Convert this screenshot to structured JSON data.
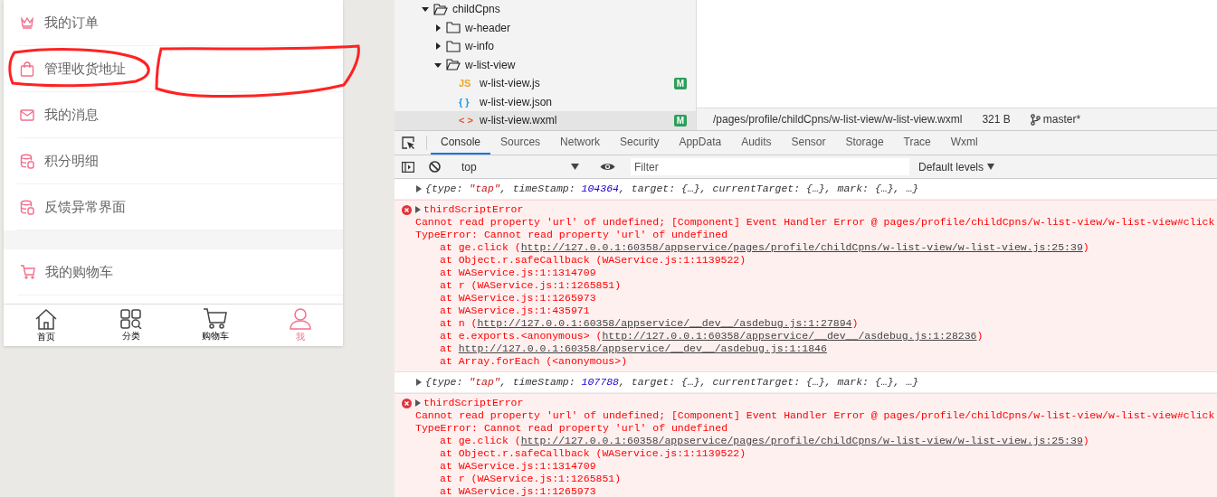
{
  "phone": {
    "menu_groups": [
      {
        "items": [
          {
            "label": "我的订单"
          },
          {
            "label": "管理收货地址"
          },
          {
            "label": "我的消息"
          },
          {
            "label": "积分明细"
          },
          {
            "label": "反馈异常界面"
          }
        ]
      },
      {
        "items": [
          {
            "label": "我的购物车"
          }
        ]
      }
    ],
    "tab_bar": [
      {
        "label": "首页",
        "selected": false
      },
      {
        "label": "分类",
        "selected": false
      },
      {
        "label": "购物车",
        "selected": false
      },
      {
        "label": "我",
        "selected": true
      }
    ]
  },
  "file_tree": [
    {
      "name": "childCpns",
      "kind": "folder",
      "expanded": true,
      "children": [
        {
          "name": "w-header",
          "kind": "folder",
          "expanded": false
        },
        {
          "name": "w-info",
          "kind": "folder",
          "expanded": false
        },
        {
          "name": "w-list-view",
          "kind": "folder",
          "expanded": true,
          "children": [
            {
              "name": "w-list-view.js",
              "kind": "js",
              "icon": "JS",
              "badge": "M",
              "selected": false
            },
            {
              "name": "w-list-view.json",
              "kind": "json",
              "icon": "{ }",
              "selected": false
            },
            {
              "name": "w-list-view.wxml",
              "kind": "wxml",
              "icon": "< >",
              "badge": "M",
              "selected": true
            }
          ]
        }
      ]
    }
  ],
  "status_bar": {
    "path": "/pages/profile/childCpns/w-list-view/w-list-view.wxml",
    "size": "321 B",
    "branch": "master*"
  },
  "devtools_tabs": [
    {
      "label": "Console",
      "selected": true
    },
    {
      "label": "Sources",
      "selected": false
    },
    {
      "label": "Network",
      "selected": false
    },
    {
      "label": "Security",
      "selected": false
    },
    {
      "label": "AppData",
      "selected": false
    },
    {
      "label": "Audits",
      "selected": false
    },
    {
      "label": "Sensor",
      "selected": false
    },
    {
      "label": "Storage",
      "selected": false
    },
    {
      "label": "Trace",
      "selected": false
    },
    {
      "label": "Wxml",
      "selected": false
    }
  ],
  "console_toolbar": {
    "context": "top",
    "filter_placeholder": "Filter",
    "levels": "Default levels"
  },
  "console": [
    {
      "kind": "object",
      "segments": [
        {
          "text": "{type: ",
          "kind": "plain"
        },
        {
          "text": "\"tap\"",
          "kind": "string"
        },
        {
          "text": ", timeStamp: ",
          "kind": "plain"
        },
        {
          "text": "104364",
          "kind": "number"
        },
        {
          "text": ", target: {…}, currentTarget: {…}, mark: {…}, …}",
          "kind": "plain"
        }
      ]
    },
    {
      "kind": "error",
      "title": "thirdScriptError",
      "lines": [
        "Cannot read property 'url' of undefined; [Component] Event Handler Error @ pages/profile/childCpns/w-list-view/w-list-view#click",
        "TypeError: Cannot read property 'url' of undefined"
      ],
      "frames": [
        {
          "text": "at ge.click (",
          "link": "http://127.0.0.1:60358/appservice/pages/profile/childCpns/w-list-view/w-list-view.js:25:39",
          "end": ")"
        },
        {
          "text": "at Object.r.safeCallback (WAService.js:1:1139522)"
        },
        {
          "text": "at WAService.js:1:1314709"
        },
        {
          "text": "at r (WAService.js:1:1265851)"
        },
        {
          "text": "at WAService.js:1:1265973"
        },
        {
          "text": "at WAService.js:1:435971"
        },
        {
          "text": "at n (",
          "link": "http://127.0.0.1:60358/appservice/__dev__/asdebug.js:1:27894",
          "end": ")"
        },
        {
          "text": "at e.exports.<anonymous> (",
          "link": "http://127.0.0.1:60358/appservice/__dev__/asdebug.js:1:28236",
          "end": ")"
        },
        {
          "text": "at ",
          "link": "http://127.0.0.1:60358/appservice/__dev__/asdebug.js:1:1846"
        },
        {
          "text": "at Array.forEach (<anonymous>)"
        }
      ]
    },
    {
      "kind": "object",
      "segments": [
        {
          "text": "{type: ",
          "kind": "plain"
        },
        {
          "text": "\"tap\"",
          "kind": "string"
        },
        {
          "text": ", timeStamp: ",
          "kind": "plain"
        },
        {
          "text": "107788",
          "kind": "number"
        },
        {
          "text": ", target: {…}, currentTarget: {…}, mark: {…}, …}",
          "kind": "plain"
        }
      ]
    },
    {
      "kind": "error",
      "title": "thirdScriptError",
      "lines": [
        "Cannot read property 'url' of undefined; [Component] Event Handler Error @ pages/profile/childCpns/w-list-view/w-list-view#click",
        "TypeError: Cannot read property 'url' of undefined"
      ],
      "frames": [
        {
          "text": "at ge.click (",
          "link": "http://127.0.0.1:60358/appservice/pages/profile/childCpns/w-list-view/w-list-view.js:25:39",
          "end": ")"
        },
        {
          "text": "at Object.r.safeCallback (WAService.js:1:1139522)"
        },
        {
          "text": "at WAService.js:1:1314709"
        },
        {
          "text": "at r (WAService.js:1:1265851)"
        },
        {
          "text": "at WAService.js:1:1265973"
        }
      ]
    }
  ]
}
